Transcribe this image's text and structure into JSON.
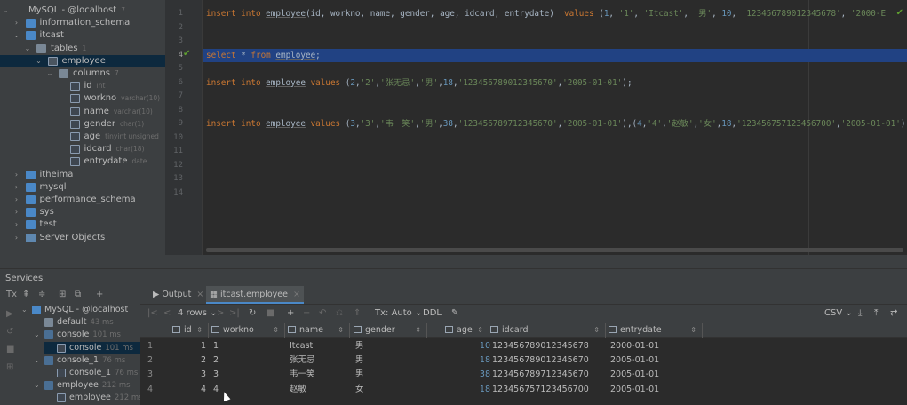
{
  "tree": [
    {
      "label": "MySQL - @localhost",
      "sub": "7",
      "depth": 0,
      "arrow": "⌄",
      "icon": "mysql"
    },
    {
      "label": "information_schema",
      "sub": "",
      "depth": 1,
      "arrow": "›",
      "icon": "db"
    },
    {
      "label": "itcast",
      "sub": "",
      "depth": 1,
      "arrow": "⌄",
      "icon": "db"
    },
    {
      "label": "tables",
      "sub": "1",
      "depth": 2,
      "arrow": "⌄",
      "icon": "fold"
    },
    {
      "label": "employee",
      "sub": "",
      "depth": 3,
      "arrow": "⌄",
      "icon": "tbl",
      "sel": true
    },
    {
      "label": "columns",
      "sub": "7",
      "depth": 4,
      "arrow": "⌄",
      "icon": "fold"
    },
    {
      "label": "id",
      "sub": "int",
      "depth": 5,
      "arrow": "",
      "icon": "fld"
    },
    {
      "label": "workno",
      "sub": "varchar(10)",
      "depth": 5,
      "arrow": "",
      "icon": "fld"
    },
    {
      "label": "name",
      "sub": "varchar(10)",
      "depth": 5,
      "arrow": "",
      "icon": "fld"
    },
    {
      "label": "gender",
      "sub": "char(1)",
      "depth": 5,
      "arrow": "",
      "icon": "fld"
    },
    {
      "label": "age",
      "sub": "tinyint unsigned",
      "depth": 5,
      "arrow": "",
      "icon": "fld"
    },
    {
      "label": "idcard",
      "sub": "char(18)",
      "depth": 5,
      "arrow": "",
      "icon": "fld"
    },
    {
      "label": "entrydate",
      "sub": "date",
      "depth": 5,
      "arrow": "",
      "icon": "fld"
    },
    {
      "label": "itheima",
      "sub": "",
      "depth": 1,
      "arrow": "›",
      "icon": "db"
    },
    {
      "label": "mysql",
      "sub": "",
      "depth": 1,
      "arrow": "›",
      "icon": "db"
    },
    {
      "label": "performance_schema",
      "sub": "",
      "depth": 1,
      "arrow": "›",
      "icon": "db"
    },
    {
      "label": "sys",
      "sub": "",
      "depth": 1,
      "arrow": "›",
      "icon": "db"
    },
    {
      "label": "test",
      "sub": "",
      "depth": 1,
      "arrow": "›",
      "icon": "db"
    },
    {
      "label": "Server Objects",
      "sub": "",
      "depth": 1,
      "arrow": "›",
      "icon": "srv"
    }
  ],
  "editor": {
    "line_numbers": [
      "1",
      "2",
      "3",
      "4",
      "5",
      "6",
      "7",
      "8",
      "9",
      "10",
      "11",
      "12",
      "13",
      "14"
    ],
    "current_line": 4,
    "lines": [
      {
        "n": 1,
        "tokens": [
          [
            "kw",
            "insert into "
          ],
          [
            "tbn",
            "employee"
          ],
          [
            "p",
            "(id, workno, name, gender, age, idcard, entrydate)  "
          ],
          [
            "kw",
            "values "
          ],
          [
            "p",
            "("
          ],
          [
            "num",
            "1"
          ],
          [
            "p",
            ", "
          ],
          [
            "str",
            "'1'"
          ],
          [
            "p",
            ", "
          ],
          [
            "str",
            "'Itcast'"
          ],
          [
            "p",
            ", "
          ],
          [
            "str",
            "'男'"
          ],
          [
            "p",
            ", "
          ],
          [
            "num",
            "10"
          ],
          [
            "p",
            ", "
          ],
          [
            "str",
            "'123456789012345678'"
          ],
          [
            "p",
            ", "
          ],
          [
            "str",
            "'2000-E"
          ]
        ]
      },
      {
        "n": 4,
        "tokens": [
          [
            "kw",
            "select "
          ],
          [
            "p",
            "* "
          ],
          [
            "kw",
            "from "
          ],
          [
            "tbn",
            "employee"
          ],
          [
            "p",
            ";"
          ]
        ]
      },
      {
        "n": 6,
        "tokens": [
          [
            "kw",
            "insert into "
          ],
          [
            "tbn",
            "employee"
          ],
          [
            "p",
            " "
          ],
          [
            "kw",
            "values "
          ],
          [
            "p",
            "("
          ],
          [
            "num",
            "2"
          ],
          [
            "p",
            ","
          ],
          [
            "str",
            "'2'"
          ],
          [
            "p",
            ","
          ],
          [
            "str",
            "'张无忌'"
          ],
          [
            "p",
            ","
          ],
          [
            "str",
            "'男'"
          ],
          [
            "p",
            ","
          ],
          [
            "num",
            "18"
          ],
          [
            "p",
            ","
          ],
          [
            "str",
            "'123456789012345670'"
          ],
          [
            "p",
            ","
          ],
          [
            "str",
            "'2005-01-01'"
          ],
          [
            "p",
            ");"
          ]
        ]
      },
      {
        "n": 9,
        "tokens": [
          [
            "kw",
            "insert into "
          ],
          [
            "tbn",
            "employee"
          ],
          [
            "p",
            " "
          ],
          [
            "kw",
            "values "
          ],
          [
            "p",
            "("
          ],
          [
            "num",
            "3"
          ],
          [
            "p",
            ","
          ],
          [
            "str",
            "'3'"
          ],
          [
            "p",
            ","
          ],
          [
            "str",
            "'韦一笑'"
          ],
          [
            "p",
            ","
          ],
          [
            "str",
            "'男'"
          ],
          [
            "p",
            ","
          ],
          [
            "num",
            "38"
          ],
          [
            "p",
            ","
          ],
          [
            "str",
            "'123456789712345670'"
          ],
          [
            "p",
            ","
          ],
          [
            "str",
            "'2005-01-01'"
          ],
          [
            "p",
            "),("
          ],
          [
            "num",
            "4"
          ],
          [
            "p",
            ","
          ],
          [
            "str",
            "'4'"
          ],
          [
            "p",
            ","
          ],
          [
            "str",
            "'赵敏'"
          ],
          [
            "p",
            ","
          ],
          [
            "str",
            "'女'"
          ],
          [
            "p",
            ","
          ],
          [
            "num",
            "18"
          ],
          [
            "p",
            ","
          ],
          [
            "str",
            "'123456757123456700'"
          ],
          [
            "p",
            ","
          ],
          [
            "str",
            "'2005-01-01'"
          ],
          [
            "p",
            "),"
          ]
        ]
      }
    ]
  },
  "services": {
    "title": "Services",
    "toolbar": [
      "Tx",
      "⇞",
      "≑",
      "⊞",
      "⧉",
      "+"
    ],
    "tree": [
      {
        "label": "MySQL - @localhost",
        "time": "",
        "depth": 0,
        "arrow": "⌄",
        "icon": "mysql"
      },
      {
        "label": "default",
        "time": "43 ms",
        "depth": 1,
        "arrow": "",
        "icon": "gen"
      },
      {
        "label": "console",
        "time": "101 ms",
        "depth": 1,
        "arrow": "⌄",
        "icon": "con"
      },
      {
        "label": "console",
        "time": "101 ms",
        "depth": 2,
        "arrow": "",
        "icon": "file",
        "sel": true
      },
      {
        "label": "console_1",
        "time": "76 ms",
        "depth": 1,
        "arrow": "⌄",
        "icon": "con"
      },
      {
        "label": "console_1",
        "time": "76 ms",
        "depth": 2,
        "arrow": "",
        "icon": "file"
      },
      {
        "label": "employee",
        "time": "212 ms",
        "depth": 1,
        "arrow": "⌄",
        "icon": "con"
      },
      {
        "label": "employee",
        "time": "212 ms",
        "depth": 2,
        "arrow": "",
        "icon": "file"
      }
    ]
  },
  "results": {
    "tabs": [
      {
        "label": "Output",
        "icon": "▶"
      },
      {
        "label": "itcast.employee",
        "icon": "▦"
      }
    ],
    "toolbar": {
      "rows": "4 rows",
      "tx": "Tx: Auto",
      "ddl": "DDL",
      "csv": "CSV"
    },
    "columns": [
      "id",
      "workno",
      "name",
      "gender",
      "age",
      "idcard",
      "entrydate"
    ],
    "rows": [
      [
        "1",
        "1",
        "1",
        "Itcast",
        "男",
        "10",
        "123456789012345678",
        "2000-01-01"
      ],
      [
        "2",
        "2",
        "2",
        "张无忌",
        "男",
        "18",
        "123456789012345670",
        "2005-01-01"
      ],
      [
        "3",
        "3",
        "3",
        "韦一笑",
        "男",
        "38",
        "123456789712345670",
        "2005-01-01"
      ],
      [
        "4",
        "4",
        "4",
        "赵敏",
        "女",
        "18",
        "123456757123456700",
        "2005-01-01"
      ]
    ]
  }
}
